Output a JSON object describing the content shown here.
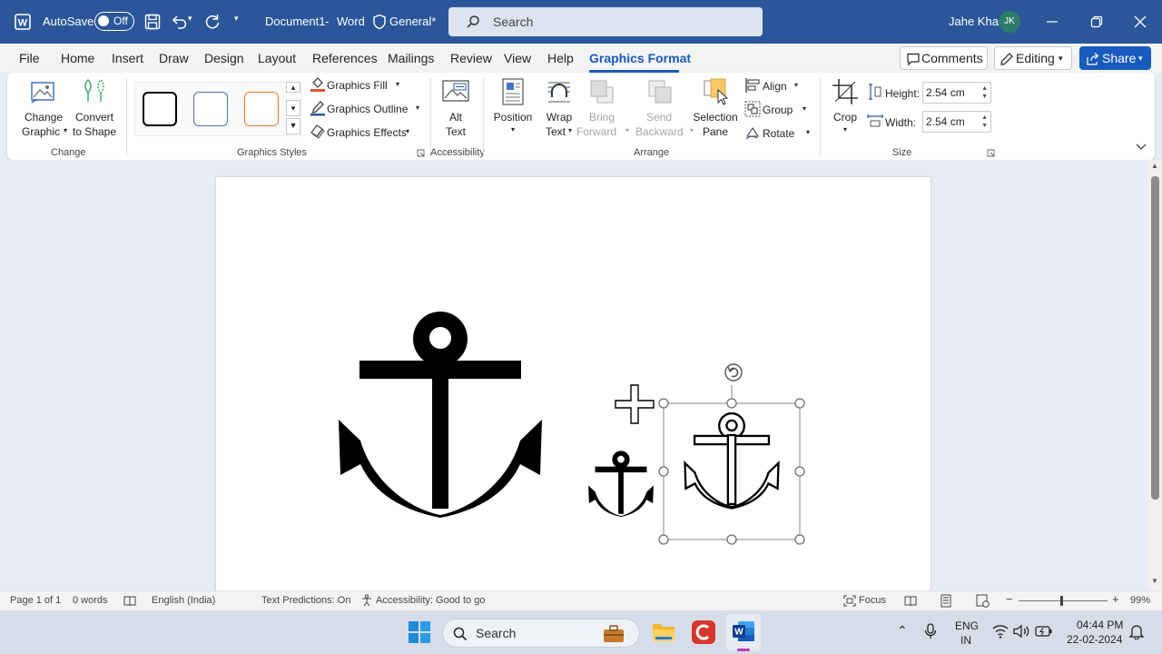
{
  "title_bar": {
    "autosave_label": "AutoSave",
    "autosave_state": "Off",
    "document_name": "Document1",
    "app_name": "Word",
    "sensitivity_label": "General*",
    "search_placeholder": "Search",
    "user_name": "Jahe Kha",
    "user_initials": "JK"
  },
  "tabs": [
    "File",
    "Home",
    "Insert",
    "Draw",
    "Design",
    "Layout",
    "References",
    "Mailings",
    "Review",
    "View",
    "Help",
    "Graphics Format"
  ],
  "active_tab": "Graphics Format",
  "header_buttons": {
    "comments": "Comments",
    "editing": "Editing",
    "share": "Share"
  },
  "ribbon": {
    "change": {
      "change_graphic_1": "Change",
      "change_graphic_2": "Graphic",
      "convert_1": "Convert",
      "convert_2": "to Shape",
      "label": "Change"
    },
    "styles": {
      "fill": "Graphics Fill",
      "outline": "Graphics Outline",
      "effects": "Graphics Effects",
      "label": "Graphics Styles",
      "swatch_colors": [
        "#000000",
        "#4472c4",
        "#ed7d31"
      ]
    },
    "accessibility": {
      "alt_text_1": "Alt",
      "alt_text_2": "Text",
      "label": "Accessibility"
    },
    "arrange": {
      "position": "Position",
      "wrap_1": "Wrap",
      "wrap_2": "Text",
      "bring_1": "Bring",
      "bring_2": "Forward",
      "send_1": "Send",
      "send_2": "Backward",
      "selection_1": "Selection",
      "selection_2": "Pane",
      "align": "Align",
      "group": "Group",
      "rotate": "Rotate",
      "label": "Arrange"
    },
    "size": {
      "crop": "Crop",
      "height_label": "Height:",
      "height_value": "2.54 cm",
      "width_label": "Width:",
      "width_value": "2.54 cm",
      "label": "Size"
    }
  },
  "status_bar": {
    "page": "Page 1 of 1",
    "words": "0 words",
    "language": "English (India)",
    "text_predictions": "Text Predictions: On",
    "accessibility": "Accessibility: Good to go",
    "focus": "Focus",
    "zoom": "99%"
  },
  "taskbar": {
    "search_placeholder": "Search",
    "lang_1": "ENG",
    "lang_2": "IN",
    "time": "04:44 PM",
    "date": "22-02-2024"
  },
  "colors": {
    "title_bar": "#2b579a",
    "accent": "#185abd",
    "page": "#ffffff",
    "selection_handle": "#6e6e6e"
  }
}
